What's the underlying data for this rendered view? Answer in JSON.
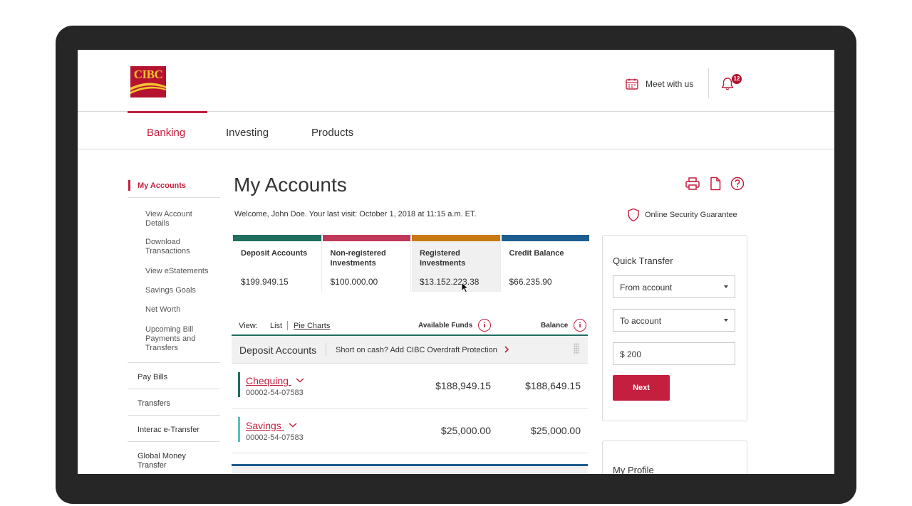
{
  "brand": {
    "logo_text": "CIBC",
    "primary_color": "#c41f3e"
  },
  "header": {
    "meet_label": "Meet with us",
    "notification_count": "12"
  },
  "nav": {
    "tabs": [
      {
        "label": "Banking",
        "active": true
      },
      {
        "label": "Investing",
        "active": false
      },
      {
        "label": "Products",
        "active": false
      }
    ]
  },
  "sidebar": {
    "active_label": "My Accounts",
    "sub_items": [
      "View Account Details",
      "Download Transactions",
      "View eStatements",
      "Savings Goals",
      "Net Worth",
      "Upcoming Bill Payments and Transfers"
    ],
    "items": [
      "Pay Bills",
      "Transfers",
      "Interac e-Transfer",
      "Global Money Transfer"
    ]
  },
  "page": {
    "title": "My Accounts",
    "welcome": "Welcome, John Doe. Your last visit: October 1, 2018 at 11:15 a.m. ET.",
    "security_label": "Online Security Guarantee"
  },
  "summary": [
    {
      "label": "Deposit Accounts",
      "amount": "$199.949.15",
      "color": "#1f6e5f"
    },
    {
      "label": "Non-registered Investments",
      "amount": "$100.000.00",
      "color": "#c0395a"
    },
    {
      "label": "Registered Investments",
      "amount": "$13.152.223.38",
      "color": "#c87a12"
    },
    {
      "label": "Credit Balance",
      "amount": "$66.235.90",
      "color": "#1d5d90"
    }
  ],
  "view": {
    "label": "View:",
    "list": "List",
    "pie": "Pie Charts",
    "available_funds": "Available Funds",
    "balance": "Balance",
    "info_glyph": "i"
  },
  "deposit": {
    "title": "Deposit Accounts",
    "promo": "Short on cash? Add CIBC Overdraft Protection",
    "rows": [
      {
        "name": "Chequing",
        "number": "00002-54-07583",
        "available": "$188,949.15",
        "balance": "$188,649.15",
        "color": "#1f6e5f"
      },
      {
        "name": "Savings",
        "number": "00002-54-07583",
        "available": "$25,000.00",
        "balance": "$25,000.00",
        "color": "#5bbfbe"
      }
    ]
  },
  "quick_transfer": {
    "title": "Quick Transfer",
    "from": "From account",
    "to": "To account",
    "amount": "$ 200",
    "next": "Next"
  },
  "profile": {
    "title": "My Profile"
  }
}
